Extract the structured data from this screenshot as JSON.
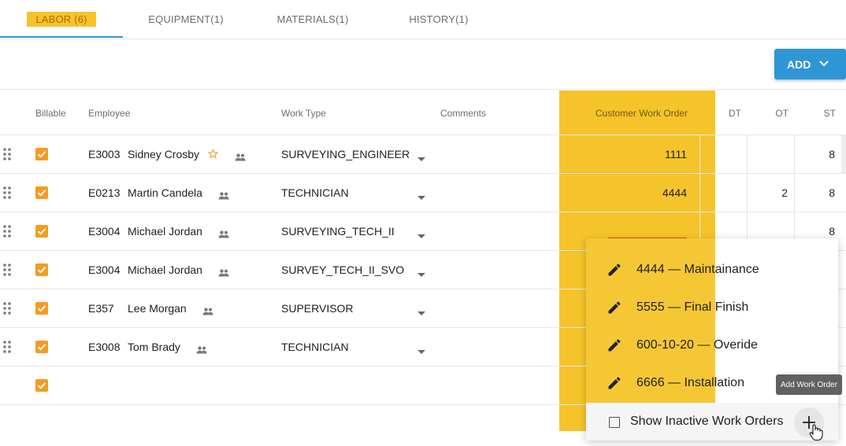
{
  "tabs": [
    {
      "label": "LABOR (6)"
    },
    {
      "label": "EQUIPMENT(1)"
    },
    {
      "label": "MATERIALS(1)"
    },
    {
      "label": "HISTORY(1)"
    }
  ],
  "toolbar": {
    "add_label": "ADD"
  },
  "columns": {
    "billable": "Billable",
    "employee": "Employee",
    "work_type": "Work Type",
    "comments": "Comments",
    "customer_work_order": "Customer Work Order",
    "dt": "DT",
    "ot": "OT",
    "st": "ST"
  },
  "rows": [
    {
      "emp_id": "E3003",
      "name": "Sidney Crosby",
      "work_type": "SURVEYING_ENGINEER",
      "cwo": "1111",
      "dt": "",
      "ot": "",
      "st": "8"
    },
    {
      "emp_id": "E0213",
      "name": "Martin Candela",
      "work_type": "TECHNICIAN",
      "cwo": "4444",
      "dt": "",
      "ot": "2",
      "st": "8"
    },
    {
      "emp_id": "E3004",
      "name": "Michael Jordan",
      "work_type": "SURVEYING_TECH_II",
      "cwo": "",
      "dt": "",
      "ot": "",
      "st": "8"
    },
    {
      "emp_id": "E3004",
      "name": "Michael Jordan",
      "work_type": "SURVEY_TECH_II_SVO",
      "cwo": "",
      "dt": "",
      "ot": "",
      "st": ""
    },
    {
      "emp_id": "E357",
      "name": "Lee Morgan",
      "work_type": "SUPERVISOR",
      "cwo": "",
      "dt": "",
      "ot": "",
      "st": ""
    },
    {
      "emp_id": "E3008",
      "name": "Tom Brady",
      "work_type": "TECHNICIAN",
      "cwo": "",
      "dt": "",
      "ot": "",
      "st": ""
    }
  ],
  "dropdown": {
    "items": [
      {
        "label": "4444 — Maintainance"
      },
      {
        "label": "5555 — Final Finish"
      },
      {
        "label": "600-10-20 — Overide"
      },
      {
        "label": "6666 — Installation"
      }
    ],
    "show_inactive_label": "Show Inactive Work Orders",
    "tooltip": "Add Work Order"
  },
  "colors": {
    "accent": "#2f96d6",
    "highlight": "#f5c42a",
    "checkbox": "#f59b22"
  },
  "icons": {
    "drag": "drag-handle-icon",
    "star": "star-outline-icon",
    "people": "people-icon",
    "pencil": "pencil-icon",
    "plus": "plus-icon",
    "cursor": "hand-pointer-icon"
  }
}
